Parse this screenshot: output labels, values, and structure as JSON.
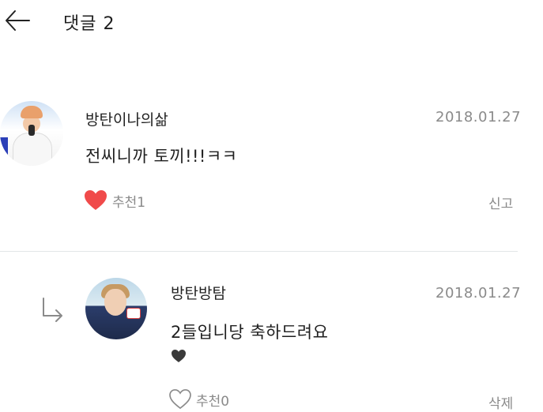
{
  "header": {
    "back_icon": "arrow-left-icon",
    "title": "댓글 2"
  },
  "comments": [
    {
      "author": "방탄이나의삶",
      "date": "2018.01.27",
      "text": "전씨니까 토끼!!!ㅋㅋ",
      "like_label": "추천1",
      "like_icon": "heart-filled-icon",
      "like_color": "#f04a4a",
      "action_label": "신고"
    }
  ],
  "reply": {
    "reply_icon": "reply-arrow-icon",
    "author": "방탄방탐",
    "date": "2018.01.27",
    "text": "2들입니당 축하드려요",
    "emoji_icon": "black-heart-icon",
    "like_label": "추천0",
    "like_icon": "heart-outline-icon",
    "action_label": "삭제"
  },
  "colors": {
    "meta_gray": "#8a8a8a",
    "divider": "#e3e6e8"
  }
}
